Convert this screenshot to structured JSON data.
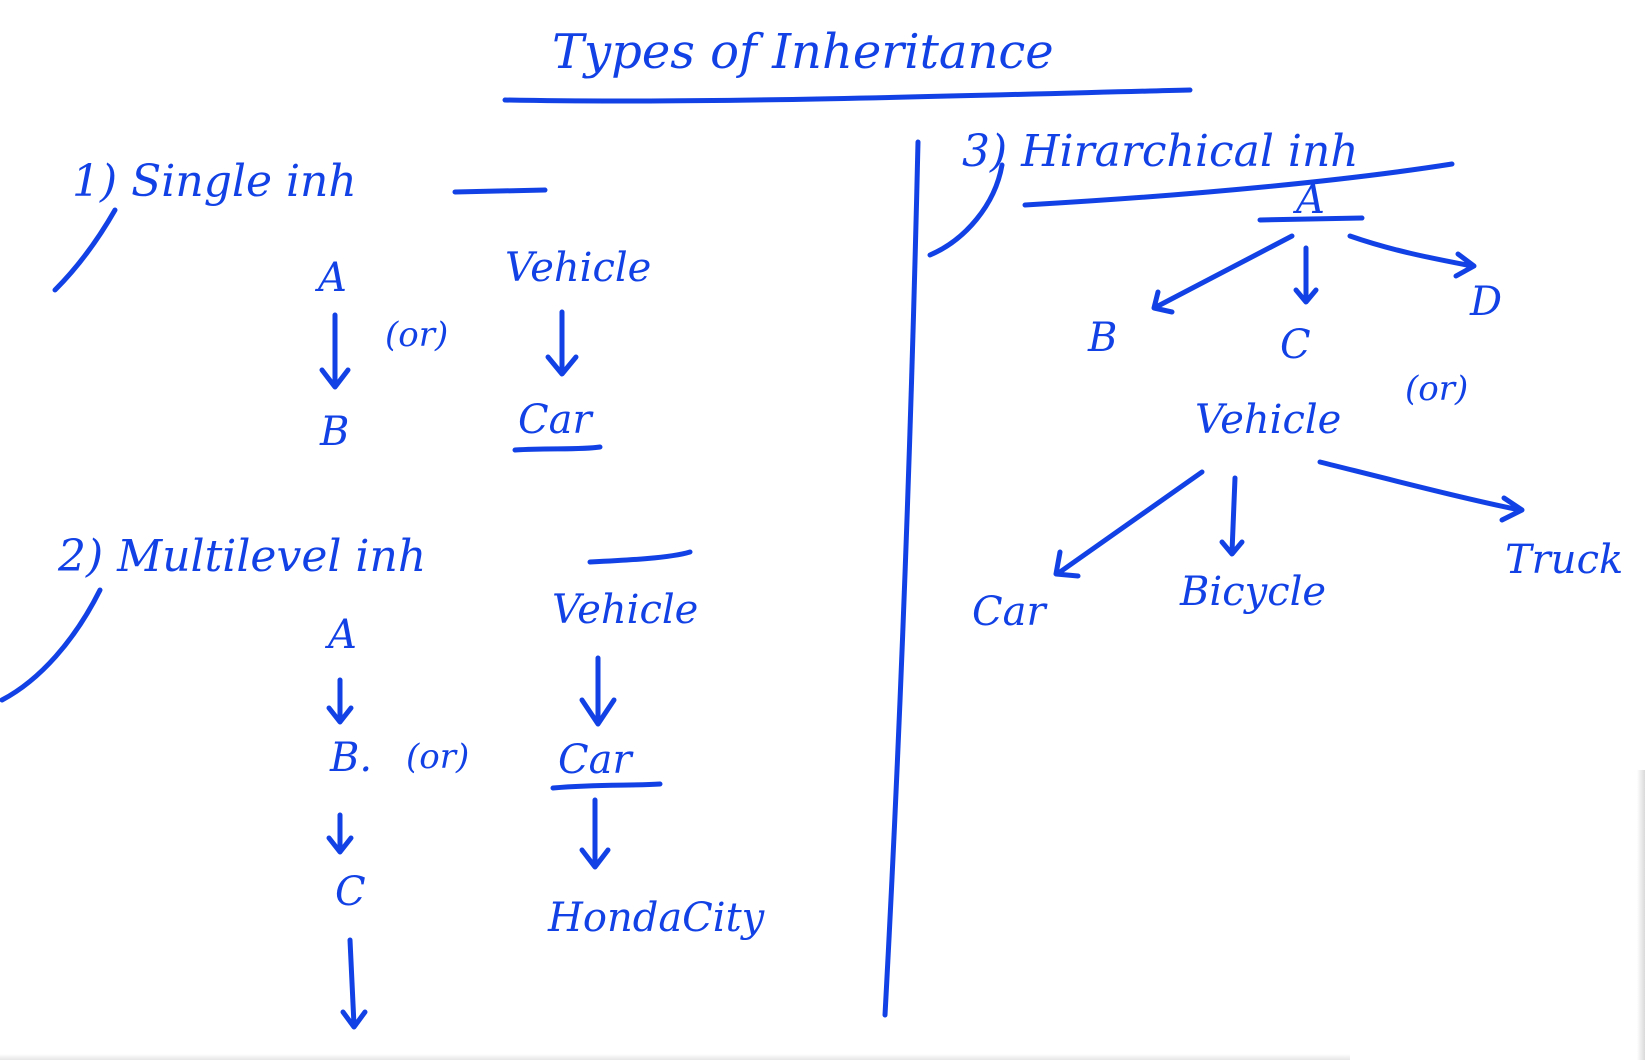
{
  "board": {
    "ink_color": "#1242e6",
    "background": "#ffffff",
    "title": "Types of Inheritance"
  },
  "single": {
    "heading": "1) Single inh",
    "letters": [
      "A",
      "B"
    ],
    "or": "(or)",
    "example": [
      "Vehicle",
      "Car"
    ]
  },
  "multilevel": {
    "heading": "2) Multilevel inh",
    "letters": [
      "A",
      "B.",
      "C"
    ],
    "or": "(or)",
    "example": [
      "Vehicle",
      "Car",
      "HondaCity"
    ]
  },
  "hierarchical": {
    "heading": "3) Hirarchical inh",
    "root": "A",
    "children": [
      "B",
      "C",
      "D"
    ],
    "or": "(or)",
    "example_root": "Vehicle",
    "example_children": [
      "Car",
      "Bicycle",
      "Truck"
    ]
  }
}
